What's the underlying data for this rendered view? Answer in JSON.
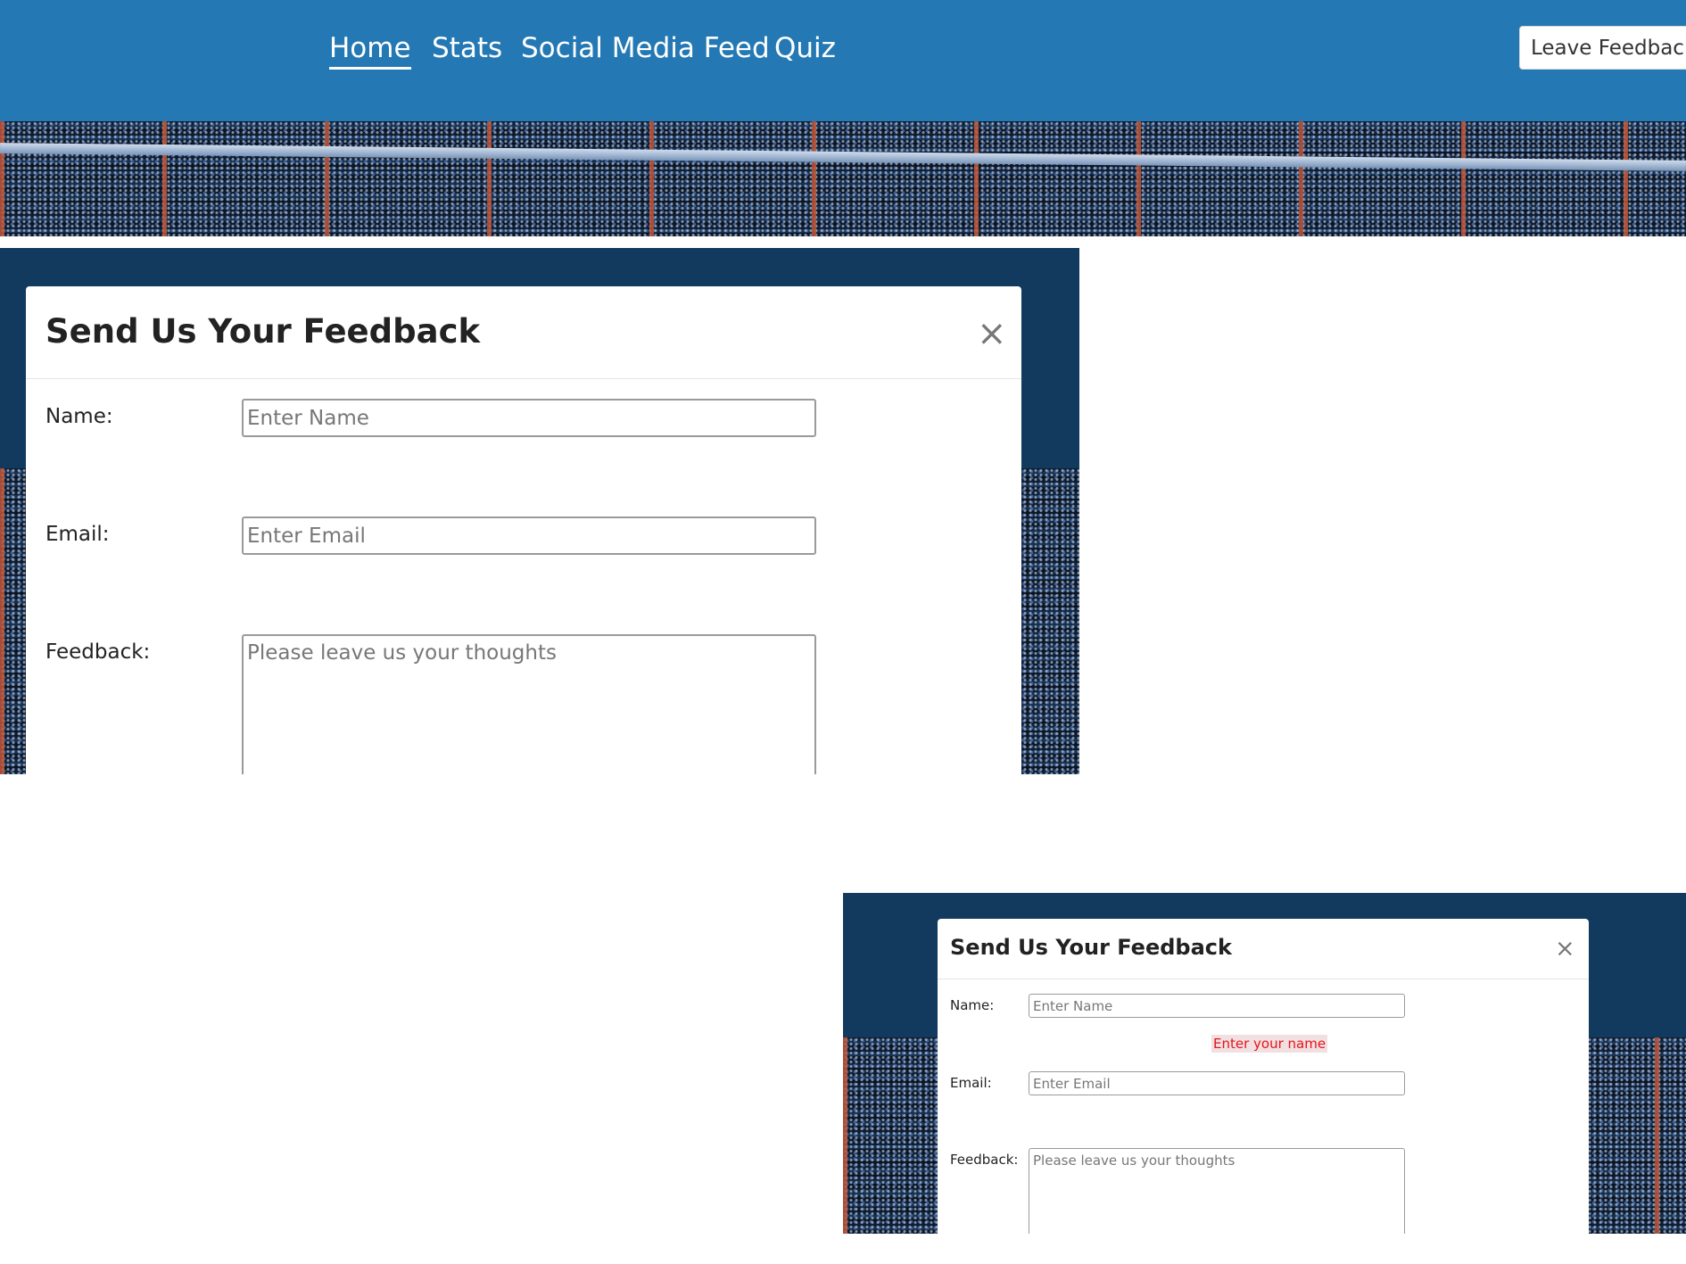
{
  "nav": {
    "links": [
      {
        "label": "Home",
        "active": true
      },
      {
        "label": "Stats",
        "active": false
      },
      {
        "label": "Social Media Feed",
        "active": false
      },
      {
        "label": "Quiz",
        "active": false
      }
    ],
    "leave_feedback_label": "Leave Feedback"
  },
  "modal_large": {
    "title": "Send Us Your Feedback",
    "close_icon": "×",
    "name_label": "Name:",
    "name_placeholder": "Enter Name",
    "email_label": "Email:",
    "email_placeholder": "Enter Email",
    "feedback_label": "Feedback:",
    "feedback_placeholder": "Please leave us your thoughts"
  },
  "modal_small": {
    "title": "Send Us Your Feedback",
    "close_icon": "×",
    "name_label": "Name:",
    "name_placeholder": "Enter Name",
    "name_error": "Enter your name",
    "email_label": "Email:",
    "email_placeholder": "Enter Email",
    "feedback_label": "Feedback:",
    "feedback_placeholder": "Please leave us your thoughts"
  },
  "colors": {
    "nav_background": "#2479b4",
    "modal_backdrop": "#113a5e",
    "error_text": "#e8141a"
  }
}
